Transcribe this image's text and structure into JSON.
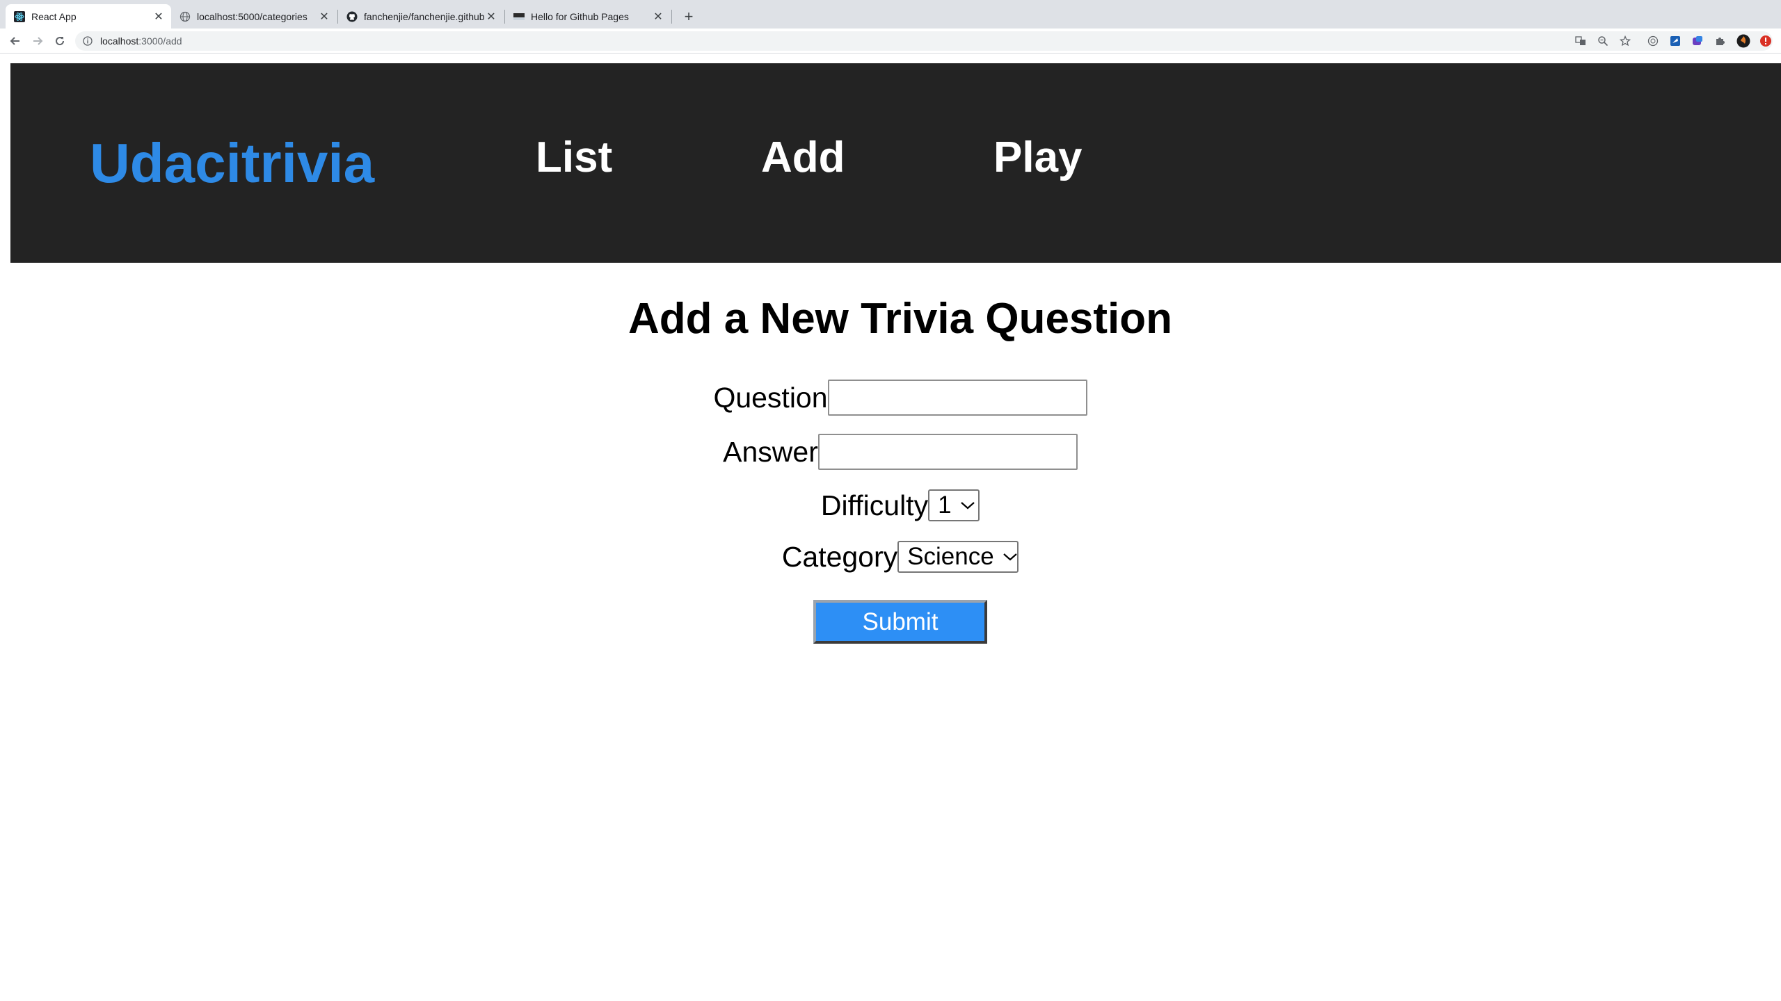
{
  "browser": {
    "tabs": [
      {
        "title": "React App",
        "active": true
      },
      {
        "title": "localhost:5000/categories",
        "active": false
      },
      {
        "title": "fanchenjie/fanchenjie.github.io",
        "active": false
      },
      {
        "title": "Hello for Github Pages",
        "active": false
      }
    ],
    "address": {
      "host": "localhost",
      "path": ":3000/add"
    }
  },
  "header": {
    "brand": "Udacitrivia",
    "nav": [
      "List",
      "Add",
      "Play"
    ]
  },
  "form": {
    "title": "Add a New Trivia Question",
    "question_label": "Question",
    "answer_label": "Answer",
    "difficulty_label": "Difficulty",
    "difficulty_value": "1",
    "category_label": "Category",
    "category_value": "Science",
    "submit_label": "Submit"
  },
  "colors": {
    "brand": "#2e8ae6",
    "header_bg": "#232323",
    "submit_bg": "#2d8ff5"
  }
}
